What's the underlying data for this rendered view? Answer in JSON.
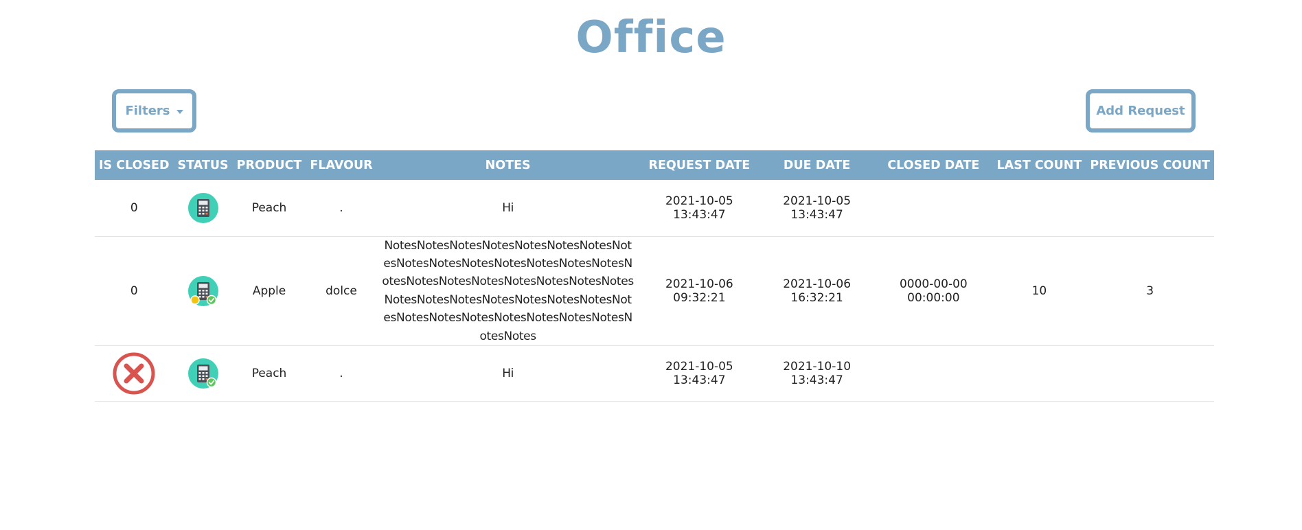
{
  "page": {
    "title": "Office"
  },
  "toolbar": {
    "filters_label": "Filters",
    "add_request_label": "Add Request"
  },
  "table": {
    "headers": [
      "IS CLOSED",
      "STATUS",
      "PRODUCT",
      "FLAVOUR",
      "NOTES",
      "REQUEST DATE",
      "DUE DATE",
      "CLOSED DATE",
      "LAST COUNT",
      "PREVIOUS COUNT"
    ],
    "rows": [
      {
        "is_closed": "0",
        "status_icon": "calculator-icon",
        "product": "Peach",
        "flavour": ".",
        "notes": "Hi",
        "request_date": "2021-10-05 13:43:47",
        "due_date": "2021-10-05 13:43:47",
        "closed_date": "",
        "last_count": "",
        "previous_count": ""
      },
      {
        "is_closed": "0",
        "status_icon": "calculator-pending-approved-icon",
        "product": "Apple",
        "flavour": "dolce",
        "notes": "NotesNotesNotesNotesNotesNotesNotesNotesNotesNotesNotesNotesNotesNotesNotesNotesNotesNotesNotesNotesNotesNotesNotesNotesNotesNotesNotesNotesNotesNotesNotesNotesNotesNotesNotesNotesNotesNotesNotesNotes",
        "request_date": "2021-10-06 09:32:21",
        "due_date": "2021-10-06 16:32:21",
        "closed_date": "0000-00-00 00:00:00",
        "last_count": "10",
        "previous_count": "3"
      },
      {
        "is_closed_icon": "close-circle-icon",
        "status_icon": "calculator-approved-icon",
        "product": "Peach",
        "flavour": ".",
        "notes": "Hi",
        "request_date": "2021-10-05 13:43:47",
        "due_date": "2021-10-10 13:43:47",
        "closed_date": "",
        "last_count": "",
        "previous_count": ""
      }
    ]
  },
  "colors": {
    "accent": "#7ba7c7",
    "status_circle": "#40d0b8",
    "close_red": "#d9534f",
    "approved_green": "#5cc85c",
    "pending_yellow": "#f1c40f"
  }
}
